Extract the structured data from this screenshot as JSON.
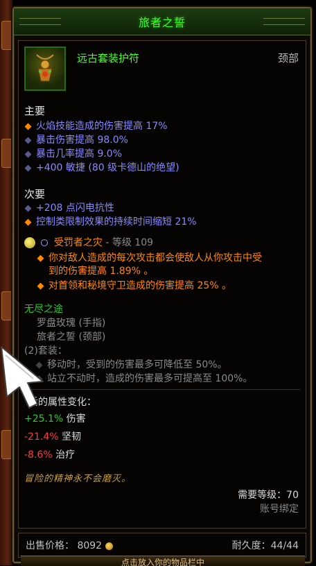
{
  "tooltip": {
    "title": "旅者之誓",
    "item_name": "远古套装护符",
    "slot": "颈部",
    "primary_header": "主要",
    "primary": [
      "火焰技能造成的伤害提高 17%",
      "暴击伤害提高 98.0%",
      "暴击几率提高 9.0%",
      "+400 敏捷  (80 级卡德山的绝望)"
    ],
    "secondary_header": "次要",
    "secondary": [
      "+208 点闪电抗性",
      "控制类限制效果的持续时间缩短 21%"
    ],
    "gem_name": "受罚者之灾",
    "gem_level": "- 等级 109",
    "gem_effects": [
      [
        "你对敌人造成的每次攻击都会使敌人从你攻击中受",
        "到的伤害提高 1.89% 。"
      ],
      [
        "对首领和秘境守卫造成的伤害提高 25% 。"
      ]
    ],
    "set_name": "无尽之途",
    "set_pieces": [
      "罗盘玫瑰 (手指)",
      "旅者之誓 (颈部)"
    ],
    "set_bonus_header": "(2)套装：",
    "set_bonuses": [
      "移动时，受到的伤害最多可降低至 50%。",
      "站立不动时，造成的伤害最多可提高至 100%。"
    ],
    "change_header": "后的属性变化：",
    "changes": [
      {
        "value": "+25.1%",
        "label": "伤害",
        "color": "#2acc2a"
      },
      {
        "value": "-21.4%",
        "label": "坚韧",
        "color": "#ff3a3a"
      },
      {
        "value": "-8.6%",
        "label": "治疗",
        "color": "#ff3a3a"
      }
    ],
    "flavor": "冒险的精神永不会磨灭。",
    "required_level": "需要等级：70",
    "bound": "账号绑定",
    "sell_label": "出售价格：",
    "sell_value": "8092",
    "durability": "耐久度：44/44",
    "bottom_button": "点击放入你的物品栏中"
  },
  "icons": {
    "item": "amulet-icon",
    "gem": "legendary-gem-icon",
    "gold": "gold-coin-icon",
    "cursor": "hand-cursor-icon"
  },
  "colors": {
    "title_green": "#3aff2a",
    "affix_blue": "#8a8aff",
    "legendary_orange": "#ff8a00",
    "set_green": "#2acc2a",
    "negative_red": "#ff3a3a"
  }
}
